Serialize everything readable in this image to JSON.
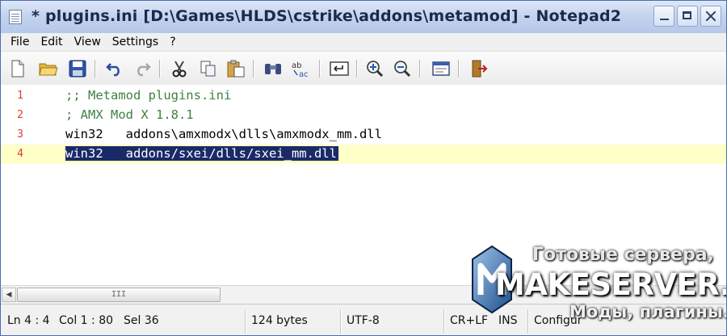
{
  "window": {
    "title": "* plugins.ini [D:\\Games\\HLDS\\cstrike\\addons\\metamod] - Notepad2"
  },
  "menu": [
    "File",
    "Edit",
    "View",
    "Settings",
    "?"
  ],
  "toolbar": {
    "icons": [
      "new-file-icon",
      "open-folder-icon",
      "save-icon",
      "undo-icon",
      "redo-icon",
      "cut-icon",
      "copy-icon",
      "paste-icon",
      "find-icon",
      "replace-icon",
      "word-wrap-icon",
      "zoom-in-icon",
      "zoom-out-icon",
      "view-icon",
      "exit-icon"
    ]
  },
  "editor": {
    "lines": [
      {
        "number": "1",
        "text": ";; Metamod plugins.ini"
      },
      {
        "number": "2",
        "text": "; AMX Mod X 1.8.1"
      },
      {
        "number": "3",
        "text": "win32   addons\\amxmodx\\dlls\\amxmodx_mm.dll"
      },
      {
        "number": "4",
        "text": "win32   addons/sxei/dlls/sxei_mm.dll"
      }
    ],
    "current_line": 4,
    "colors": {
      "line_numbers": "#e03a3a",
      "comment": "#408040",
      "selection": "#1a2a68",
      "current_line": "#ffffc8"
    }
  },
  "statusbar": {
    "position": "Ln 4 : 4",
    "column": "Col 1 : 80",
    "selection": "Sel 36",
    "size": "124 bytes",
    "encoding": "UTF-8",
    "eol": "CR+LF",
    "mode": "INS",
    "scheme": "Configur"
  },
  "scrollbar": {
    "thumb_grip": "III"
  },
  "watermark": {
    "top": "Готовые сервера,",
    "brand": "MAKESERVER.RU",
    "bottom": "Моды, плагины."
  }
}
